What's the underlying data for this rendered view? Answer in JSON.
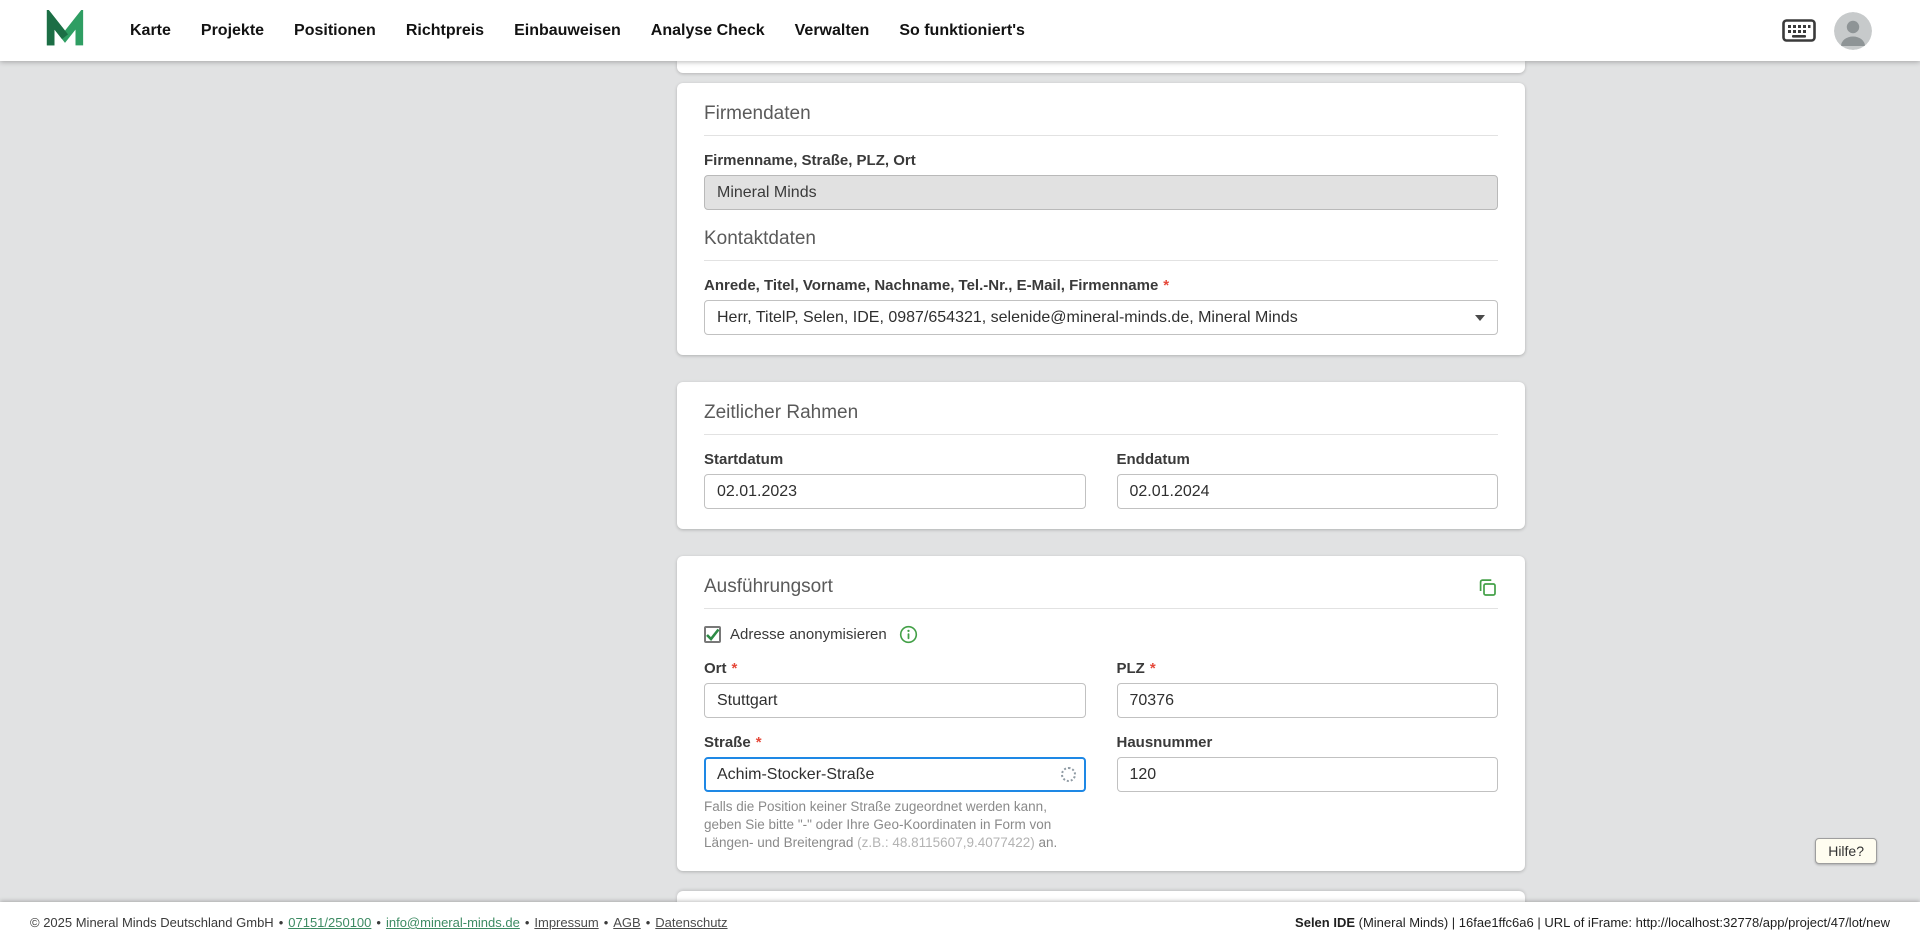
{
  "nav": {
    "items": [
      "Karte",
      "Projekte",
      "Positionen",
      "Richtpreis",
      "Einbauweisen",
      "Analyse Check",
      "Verwalten",
      "So funktioniert's"
    ]
  },
  "required_marker": "*",
  "separator": "•",
  "firmendaten": {
    "title": "Firmendaten",
    "address_label": "Firmenname, Straße, PLZ, Ort",
    "address_value": "Mineral Minds",
    "kontakt_title": "Kontaktdaten",
    "kontakt_label": "Anrede, Titel, Vorname, Nachname, Tel.-Nr., E-Mail, Firmenname",
    "kontakt_value": "Herr, TitelP, Selen, IDE, 0987/654321, selenide@mineral-minds.de, Mineral Minds"
  },
  "zeitraum": {
    "title": "Zeitlicher Rahmen",
    "start_label": "Startdatum",
    "start_value": "02.01.2023",
    "end_label": "Enddatum",
    "end_value": "02.01.2024"
  },
  "ort": {
    "title": "Ausführungsort",
    "anonymize_label": "Adresse anonymisieren",
    "ort_label": "Ort",
    "ort_value": "Stuttgart",
    "plz_label": "PLZ",
    "plz_value": "70376",
    "strasse_label": "Straße",
    "strasse_value": "Achim-Stocker-Straße",
    "hausnummer_label": "Hausnummer",
    "hausnummer_value": "120",
    "hint_text": "Falls die Position keiner Straße zugeordnet werden kann, geben Sie bitte \"-\" oder Ihre Geo-Koordinaten in Form von Längen- und Breitengrad ",
    "hint_coords": "(z.B.: 48.8115607,9.4077422)",
    "hint_end": " an.",
    "colors": {
      "accent_green": "#43a047",
      "focus_blue": "#1e88e5",
      "required_red": "#e5493a"
    }
  },
  "help_label": "Hilfe?",
  "footer": {
    "copyright": "© 2025 Mineral Minds Deutschland GmbH",
    "phone": "07151/250100",
    "email": "info@mineral-minds.de",
    "impressum": "Impressum",
    "agb": "AGB",
    "datenschutz": "Datenschutz",
    "right_app": "Selen IDE",
    "right_info": " (Mineral Minds) | 16fae1ffc6a6 | URL of iFrame: http://localhost:32778/app/project/47/lot/new"
  }
}
